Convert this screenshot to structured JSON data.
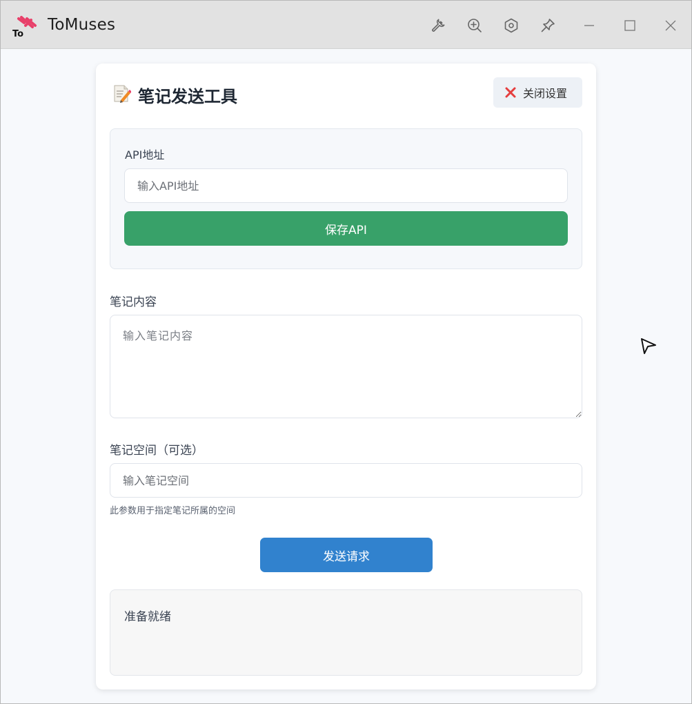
{
  "window": {
    "app_title": "ToMuses",
    "logo_text": "To",
    "toolbar_icons": [
      "wrench-icon",
      "zoom-in-icon",
      "hexagon-settings-icon",
      "pin-icon",
      "minimize-icon",
      "maximize-icon",
      "close-icon"
    ]
  },
  "card": {
    "title": "笔记发送工具",
    "close_settings_label": "关闭设置"
  },
  "api": {
    "label": "API地址",
    "value": "",
    "placeholder": "输入API地址",
    "save_label": "保存API"
  },
  "note": {
    "content_label": "笔记内容",
    "content_value": "",
    "content_placeholder": "输入笔记内容",
    "space_label": "笔记空间（可选）",
    "space_value": "",
    "space_placeholder": "输入笔记空间",
    "space_hint": "此参数用于指定笔记所属的空间"
  },
  "send_label": "发送请求",
  "status": "准备就绪",
  "colors": {
    "save_button": "#38a169",
    "send_button": "#3182ce",
    "close_x": "#e53e3e",
    "logo_accent": "#e8406a"
  }
}
